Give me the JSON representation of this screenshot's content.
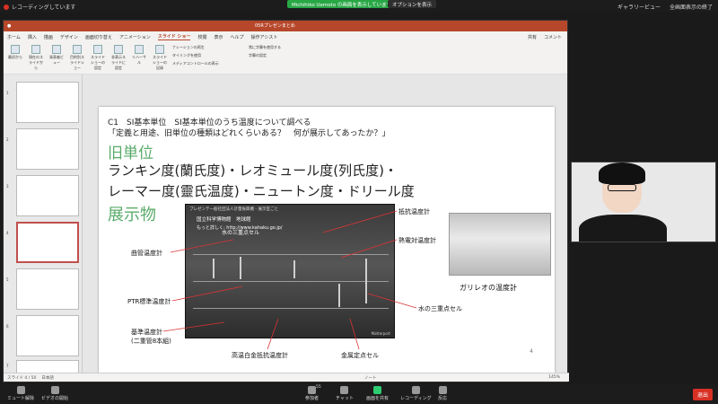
{
  "zoom": {
    "recording_text": "レコーディングしています",
    "sharing_banner": "Michihiko Uemoto の画面を表示しています",
    "view_options": "オプションを表示",
    "gallery_view": "ギャラリービュー",
    "fullscreen_exit": "全画面表示の終了",
    "toolbar": {
      "mute": "ミュート解除",
      "video": "ビデオの開始",
      "participants": "参加者",
      "participants_count": "55",
      "chat": "チャット",
      "share": "画面を共有",
      "record": "レコーディング",
      "reactions": "反応",
      "end": "退出"
    }
  },
  "ppt": {
    "filename": "05Rプレゼンまとめ",
    "tabs": [
      "ホーム",
      "挿入",
      "描画",
      "デザイン",
      "画面切り替え",
      "アニメーション",
      "スライド ショー",
      "校閲",
      "表示",
      "ヘルプ",
      "操作アシスト"
    ],
    "share_label": "共有",
    "comment_label": "コメント",
    "ribbon": [
      "最初から",
      "現在のスライドから",
      "発表者ビュー",
      "目的別スライドショー",
      "スライドショーの設定",
      "非表示スライドに設定",
      "リハーサル",
      "スライドショーの記録",
      "ナレーションの再生",
      "タイミングを使用",
      "メディアコントロールの表示",
      "常に字幕を使用する",
      "字幕の設定"
    ],
    "status_slide": "スライド 4 / 50",
    "status_lang": "日本語",
    "status_notes": "ノート",
    "status_zoom": "145%"
  },
  "slide": {
    "line1": "C1　SI基本単位　SI基本単位のうち温度について調べる",
    "line2": "「定義と用途、旧単位の種類はどれくらいある？　何が展示してあったか？」",
    "heading_old": "旧単位",
    "units_row1": "ランキン度(蘭氏度)・レオミュール度(列氏度)・",
    "units_row2": "レーマー度(靈氏温度)・ニュートン度・ドリール度",
    "heading_exhibit": "展示物",
    "photo_caption_top": "プレゼンテ一般社団法人計量振興機 - 展示室ごと",
    "photo_caption": "国立科学博物館　地球館",
    "photo_link": "もっと詳しく: http://www.kahaku.go.jp/",
    "photo_watermark": "Matterport",
    "labels": {
      "curved": "曲管温度計",
      "ptr": "PTR標準温度計",
      "reference": "基準温度計",
      "reference2": "(二重管8本組)",
      "resistance": "抵抗温度計",
      "thermocouple": "熱電対温度計",
      "triple_point_top": "水の三重点セル",
      "triple_point": "水の三重点セル",
      "platinum": "高温白金抵抗温度計",
      "metal_fixed": "金属定点セル",
      "galileo": "ガリレオの温度計"
    },
    "slide_number": "4"
  },
  "thumbnails": [
    "1",
    "2",
    "3",
    "4",
    "5",
    "6",
    "7"
  ]
}
